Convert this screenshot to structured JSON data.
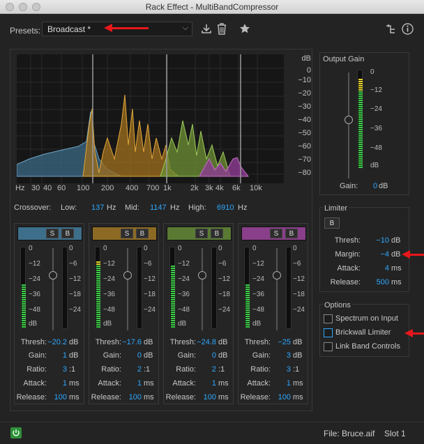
{
  "window": {
    "title": "Rack Effect - MultiBandCompressor"
  },
  "presets": {
    "label": "Presets:",
    "value": "Broadcast *"
  },
  "toolbar": {
    "save_icon": "download-icon",
    "delete_icon": "trash-icon",
    "favorite_icon": "star-icon",
    "routing_icon": "routing-icon",
    "info_icon": "info-icon"
  },
  "spectrum": {
    "db_unit": "dB",
    "db_ticks": [
      "0",
      "−10",
      "−20",
      "−30",
      "−40",
      "−50",
      "−60",
      "−70",
      "−80"
    ],
    "freq_unit": "Hz",
    "freq_ticks": [
      "30",
      "40",
      "60",
      "100",
      "200",
      "400",
      "700",
      "1k",
      "2k",
      "3k",
      "4k",
      "6k",
      "10k"
    ]
  },
  "crossover": {
    "label": "Crossover:",
    "low_label": "Low:",
    "low_value": "137",
    "low_unit": "Hz",
    "mid_label": "Mid:",
    "mid_value": "1147",
    "mid_unit": "Hz",
    "high_label": "High:",
    "high_value": "6910",
    "high_unit": "Hz"
  },
  "band_meter_scale": [
    "0",
    "−12",
    "−24",
    "−36",
    "−48",
    "dB"
  ],
  "band_gr_scale": [
    "0",
    "−6",
    "−12",
    "−18",
    "−24"
  ],
  "bands": [
    {
      "color": "#3e6f8a",
      "solo": "S",
      "bypass": "B",
      "meter_level": 0.55,
      "thresh_label": "Thresh:",
      "thresh": "−20.2",
      "thresh_unit": "dB",
      "gain_label": "Gain:",
      "gain": "1",
      "gain_unit": "dB",
      "ratio_label": "Ratio:",
      "ratio": "3",
      "ratio_unit": ":1",
      "attack_label": "Attack:",
      "attack": "1",
      "attack_unit": "ms",
      "release_label": "Release:",
      "release": "100",
      "release_unit": "ms"
    },
    {
      "color": "#8c6a24",
      "solo": "S",
      "bypass": "B",
      "meter_level": 0.85,
      "thresh_label": "Thresh:",
      "thresh": "−17.6",
      "thresh_unit": "dB",
      "gain_label": "Gain:",
      "gain": "0",
      "gain_unit": "dB",
      "ratio_label": "Ratio:",
      "ratio": "2",
      "ratio_unit": ":1",
      "attack_label": "Attack:",
      "attack": "1",
      "attack_unit": "ms",
      "release_label": "Release:",
      "release": "100",
      "release_unit": "ms"
    },
    {
      "color": "#5a7a33",
      "solo": "S",
      "bypass": "B",
      "meter_level": 0.8,
      "thresh_label": "Thresh:",
      "thresh": "−24.8",
      "thresh_unit": "dB",
      "gain_label": "Gain:",
      "gain": "0",
      "gain_unit": "dB",
      "ratio_label": "Ratio:",
      "ratio": "2",
      "ratio_unit": ":1",
      "attack_label": "Attack:",
      "attack": "1",
      "attack_unit": "ms",
      "release_label": "Release:",
      "release": "100",
      "release_unit": "ms"
    },
    {
      "color": "#8a3f8a",
      "solo": "S",
      "bypass": "B",
      "meter_level": 0.55,
      "thresh_label": "Thresh:",
      "thresh": "−25",
      "thresh_unit": "dB",
      "gain_label": "Gain:",
      "gain": "3",
      "gain_unit": "dB",
      "ratio_label": "Ratio:",
      "ratio": "3",
      "ratio_unit": ":1",
      "attack_label": "Attack:",
      "attack": "1",
      "attack_unit": "ms",
      "release_label": "Release:",
      "release": "100",
      "release_unit": "ms"
    }
  ],
  "output_gain": {
    "title": "Output Gain",
    "scale": [
      "0",
      "−12",
      "−24",
      "−36",
      "−48",
      "dB"
    ],
    "gain_label": "Gain:",
    "gain_value": "0",
    "gain_unit": "dB",
    "meter_level": 0.92
  },
  "limiter": {
    "title": "Limiter",
    "bypass": "B",
    "thresh_label": "Thresh:",
    "thresh_value": "−10",
    "thresh_unit": "dB",
    "margin_label": "Margin:",
    "margin_value": "−4",
    "margin_unit": "dB",
    "attack_label": "Attack:",
    "attack_value": "4",
    "attack_unit": "ms",
    "release_label": "Release:",
    "release_value": "500",
    "release_unit": "ms"
  },
  "options": {
    "title": "Options",
    "items": [
      {
        "label": "Spectrum on Input",
        "checked": false
      },
      {
        "label": "Brickwall Limiter",
        "checked": false
      },
      {
        "label": "Link Band Controls",
        "checked": false
      }
    ]
  },
  "footer": {
    "power_icon": "power-icon",
    "file": "File: Bruce.aif",
    "slot": "Slot 1"
  },
  "colors": {
    "accent_blue": "#2ea8ff",
    "annotation_red": "#e8171c",
    "meter_green": "#3fcf4a",
    "meter_yellow": "#e5d42a",
    "meter_red": "#e83a2a"
  }
}
